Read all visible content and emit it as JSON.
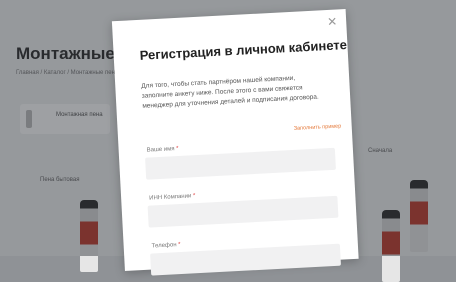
{
  "background": {
    "title": "Монтажные пе",
    "breadcrumb": "Главная / Каталог / Монтажные пены",
    "card": {
      "name": "Монтажная пена",
      "sub": ""
    },
    "filter_left": "Пена бытовая",
    "filter_right": "Сначала"
  },
  "modal": {
    "title": "Регистрация в личном кабинете",
    "description": "Для того, чтобы стать партнёром нашей компании, заполните анкету ниже. После этого с вами свяжется менеджер для уточнения деталей и подписания договора.",
    "fill_example": "Заполнить пример",
    "close_icon": "close-icon",
    "fields": [
      {
        "label": "Ваше имя",
        "required_mark": "*",
        "value": "",
        "placeholder": ""
      },
      {
        "label": "ИНН Компании",
        "required_mark": "*",
        "value": "",
        "placeholder": ""
      },
      {
        "label": "Телефон",
        "required_mark": "*",
        "value": "",
        "placeholder": ""
      }
    ]
  },
  "colors": {
    "accent": "#e57a3b",
    "required": "#e04646",
    "input_bg": "#f1f1f2",
    "overlay": "#8f9296"
  }
}
